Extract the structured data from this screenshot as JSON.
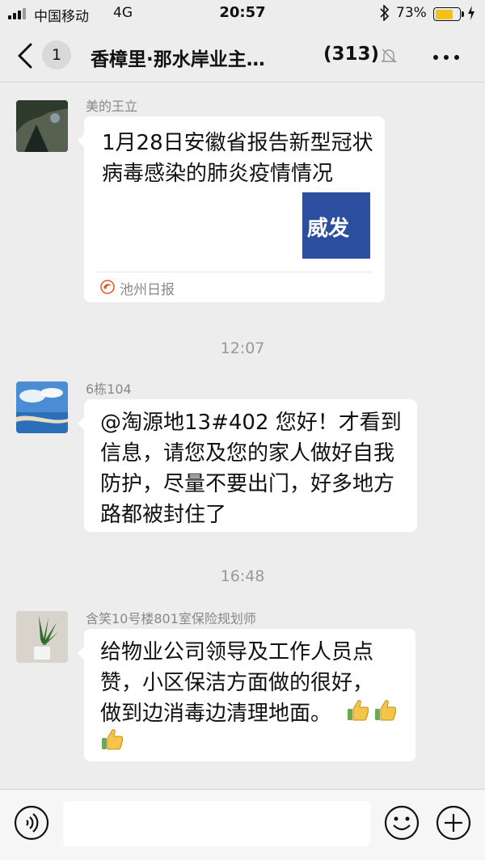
{
  "status_bar": {
    "carrier": "中国移动",
    "network": "4G",
    "time": "20:57",
    "battery_percent": "73%",
    "battery_level": 0.73,
    "battery_color": "#f2c21b"
  },
  "nav": {
    "unread_count": "1",
    "title": "香樟里·那水岸业主…",
    "member_count": "(313)"
  },
  "messages": [
    {
      "sender": "美的王立",
      "type": "article",
      "article_title": "1月28日安徽省报告新型冠状病毒感染的肺炎疫情情况",
      "thumb_text": "威发",
      "source": "池州日报"
    },
    {
      "timestamp": "12:07"
    },
    {
      "sender": "6栋104",
      "type": "text",
      "text": "@淘源地13#402 您好！才看到信息，请您及您的家人做好自我防护，尽量不要出门，好多地方路都被封住了"
    },
    {
      "timestamp": "16:48"
    },
    {
      "sender": "含笑10号楼801室保险规划师",
      "type": "text",
      "text": "给物业公司领导及工作人员点赞，小区保洁方面做的很好，做到边消毒边清理地面。",
      "emoji": [
        "thumbs-up",
        "thumbs-up",
        "thumbs-up"
      ]
    }
  ],
  "colors": {
    "background": "#ededed",
    "bubble": "#ffffff",
    "thumb_bg": "#2c4e9e",
    "source_logo": "#e2522e"
  }
}
